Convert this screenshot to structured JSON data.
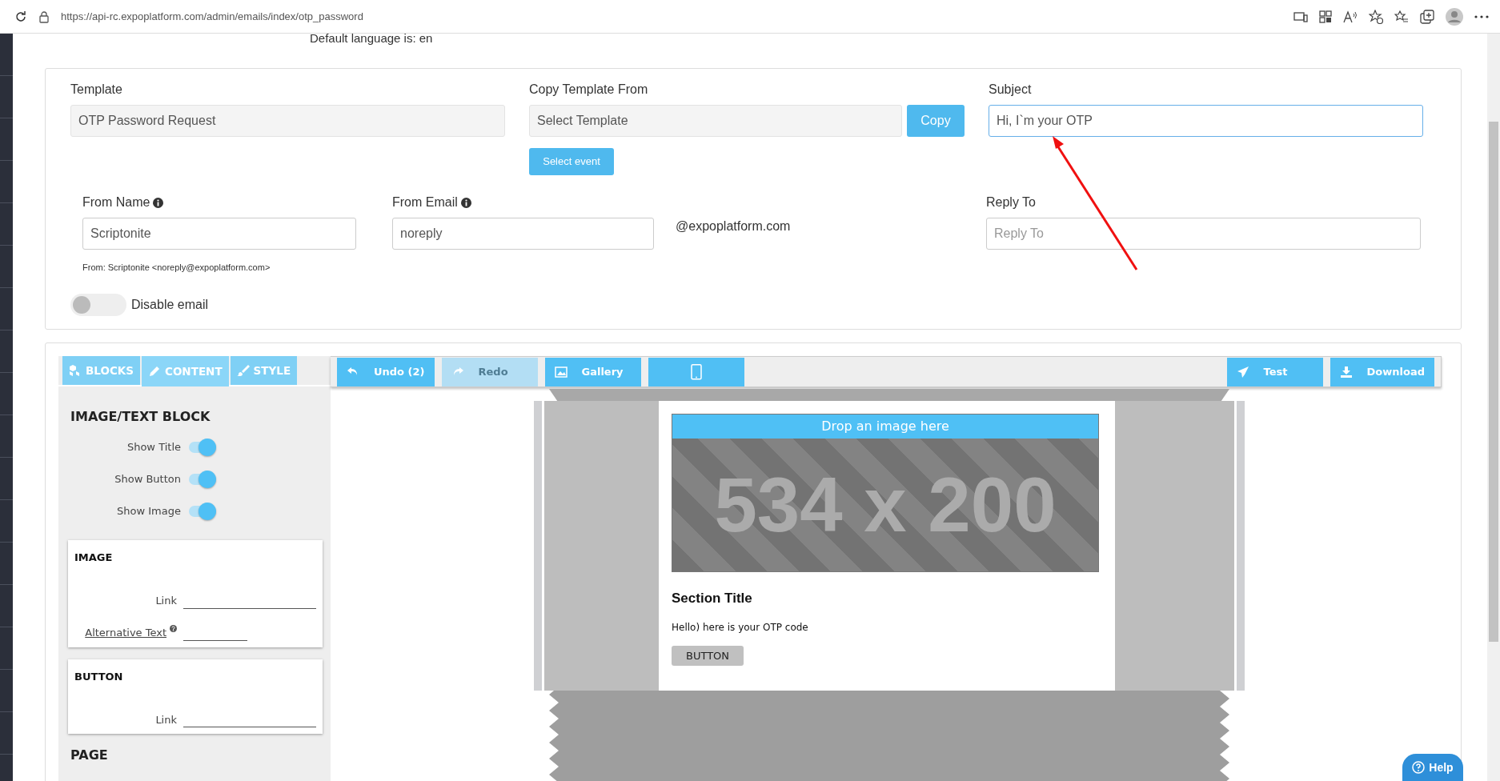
{
  "browser": {
    "url": "https://api-rc.expoplatform.com/admin/emails/index/otp_password"
  },
  "default_language": "Default language is: en",
  "settings": {
    "template": {
      "label": "Template",
      "value": "OTP Password Request"
    },
    "copy_template": {
      "label": "Copy Template From",
      "value": "Select Template",
      "copy_button": "Copy",
      "select_event_button": "Select event"
    },
    "subject": {
      "label": "Subject",
      "value": "Hi, I`m your OTP",
      "focused": true
    },
    "from_name": {
      "label": "From Name",
      "value": "Scriptonite"
    },
    "from_email": {
      "label": "From Email",
      "value": "noreply",
      "domain": "@expoplatform.com"
    },
    "reply_to": {
      "label": "Reply To",
      "placeholder": "Reply To"
    },
    "from_preview": "From: Scriptonite <noreply@expoplatform.com>",
    "disable_email": {
      "label": "Disable email",
      "on": false
    }
  },
  "editor": {
    "panel_tabs": [
      {
        "kind": "blocks",
        "label": "BLOCKS",
        "selected": false
      },
      {
        "kind": "content",
        "label": "CONTENT",
        "selected": true
      },
      {
        "kind": "style",
        "label": "STYLE",
        "selected": false
      }
    ],
    "toolbar_left": [
      {
        "kind": "undo",
        "label": "Undo (2)",
        "disabled": false
      },
      {
        "kind": "redo",
        "label": "Redo",
        "disabled": true
      },
      {
        "kind": "gallery",
        "label": "Gallery",
        "disabled": false
      },
      {
        "kind": "preview",
        "disabled": false
      }
    ],
    "toolbar_right": [
      {
        "kind": "test",
        "label": "Test"
      },
      {
        "kind": "download",
        "label": "Download"
      }
    ],
    "block_title": "IMAGE/TEXT BLOCK",
    "toggles": [
      {
        "label": "Show Title",
        "on": true
      },
      {
        "label": "Show Button",
        "on": true
      },
      {
        "label": "Show Image",
        "on": true
      }
    ],
    "sections": [
      {
        "title": "IMAGE",
        "fields": [
          {
            "kind": "plain",
            "label": "Link"
          },
          {
            "kind": "help",
            "label": "Alternative Text"
          }
        ]
      },
      {
        "title": "BUTTON",
        "fields": [
          {
            "kind": "plain",
            "label": "Link"
          }
        ]
      }
    ],
    "page_title": "PAGE",
    "preview": {
      "drop_label": "Drop an image here",
      "image_size": "534 x 200",
      "section_title": "Section Title",
      "body": "Hello) here is your OTP code",
      "button": "BUTTON"
    }
  },
  "help_button": "Help"
}
